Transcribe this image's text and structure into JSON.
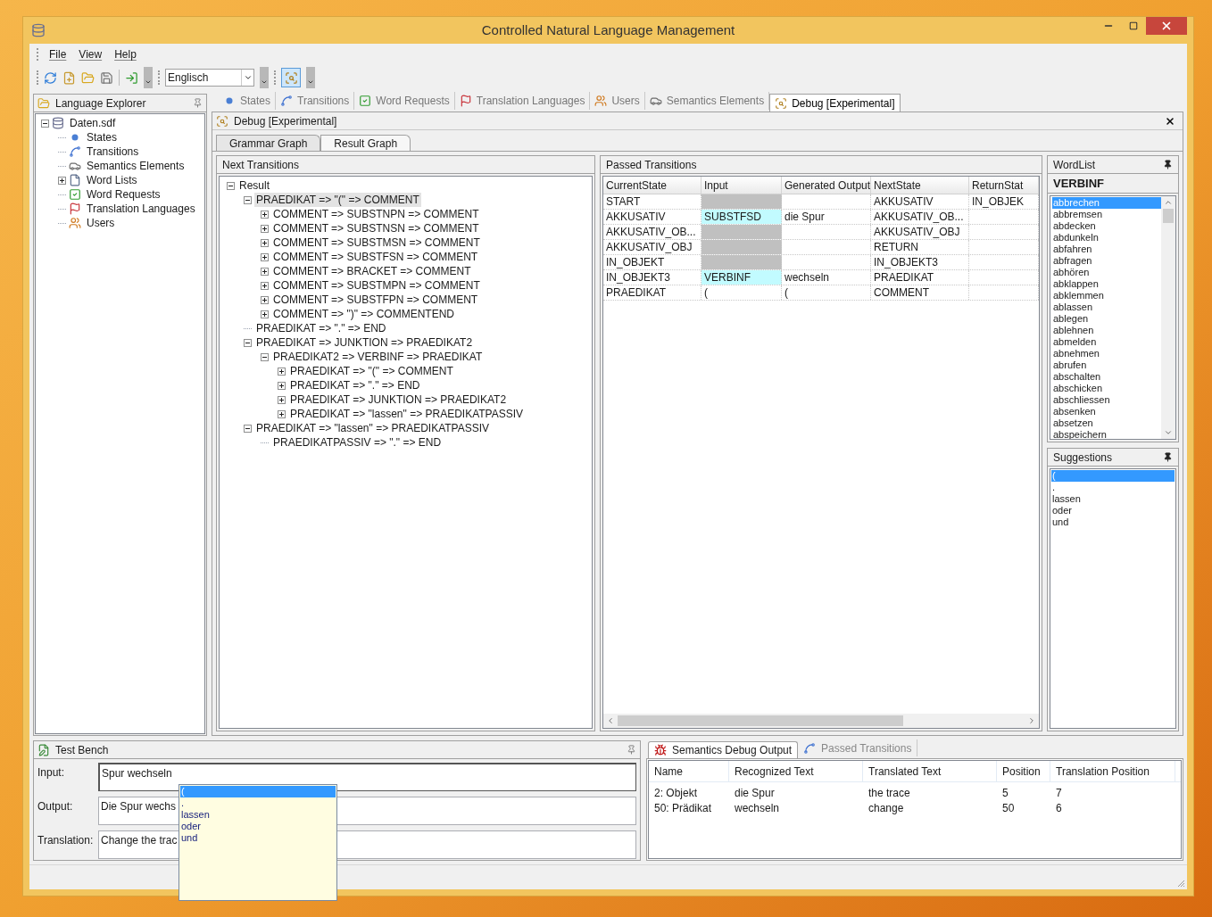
{
  "window": {
    "title": "Controlled Natural Language Management"
  },
  "menu": [
    "File",
    "View",
    "Help"
  ],
  "toolbar": {
    "language": "Englisch",
    "debug_on": true
  },
  "explorer": {
    "title": "Language Explorer",
    "tree": [
      {
        "label": "Daten.sdf",
        "expanded": true,
        "children": [
          {
            "label": "States"
          },
          {
            "label": "Transitions"
          },
          {
            "label": "Semantics Elements"
          },
          {
            "label": "Word Lists",
            "expanded": false
          },
          {
            "label": "Word Requests"
          },
          {
            "label": "Translation Languages"
          },
          {
            "label": "Users"
          }
        ]
      }
    ]
  },
  "doc_tabs": [
    {
      "label": "States",
      "selected": false
    },
    {
      "label": "Transitions",
      "selected": false
    },
    {
      "label": "Word Requests",
      "selected": false
    },
    {
      "label": "Translation Languages",
      "selected": false
    },
    {
      "label": "Users",
      "selected": false
    },
    {
      "label": "Semantics Elements",
      "selected": false
    },
    {
      "label": "Debug [Experimental]",
      "selected": true
    }
  ],
  "document": {
    "title": "Debug [Experimental]",
    "sub_tabs": [
      {
        "label": "Grammar Graph",
        "selected": false
      },
      {
        "label": "Result Graph",
        "selected": true
      }
    ]
  },
  "next_transitions": {
    "title": "Next Transitions",
    "tree": [
      {
        "label": "Result",
        "expanded": true,
        "selected": false,
        "children": [
          {
            "label": "PRAEDIKAT => \"(\" => COMMENT",
            "expanded": true,
            "selected": true,
            "children": [
              {
                "label": "COMMENT => SUBSTNPN => COMMENT",
                "expanded": false,
                "selected": false
              },
              {
                "label": "COMMENT => SUBSTNSN => COMMENT",
                "expanded": false,
                "selected": false
              },
              {
                "label": "COMMENT => SUBSTMSN => COMMENT",
                "expanded": false,
                "selected": false
              },
              {
                "label": "COMMENT => SUBSTFSN => COMMENT",
                "expanded": false,
                "selected": false
              },
              {
                "label": "COMMENT => BRACKET => COMMENT",
                "expanded": false,
                "selected": false
              },
              {
                "label": "COMMENT => SUBSTMPN => COMMENT",
                "expanded": false,
                "selected": false
              },
              {
                "label": "COMMENT => SUBSTFPN => COMMENT",
                "expanded": false,
                "selected": false
              },
              {
                "label": "COMMENT => \")\" => COMMENTEND",
                "expanded": false,
                "selected": false
              }
            ]
          },
          {
            "label": "PRAEDIKAT => \".\" => END",
            "selected": false
          },
          {
            "label": "PRAEDIKAT => JUNKTION => PRAEDIKAT2",
            "expanded": true,
            "selected": false,
            "children": [
              {
                "label": "PRAEDIKAT2 => VERBINF => PRAEDIKAT",
                "expanded": true,
                "selected": false,
                "children": [
                  {
                    "label": "PRAEDIKAT => \"(\" => COMMENT",
                    "expanded": false,
                    "selected": false
                  },
                  {
                    "label": "PRAEDIKAT => \".\" => END",
                    "expanded": false,
                    "selected": false
                  },
                  {
                    "label": "PRAEDIKAT => JUNKTION => PRAEDIKAT2",
                    "expanded": false,
                    "selected": false
                  },
                  {
                    "label": "PRAEDIKAT => \"lassen\" => PRAEDIKATPASSIV",
                    "expanded": false,
                    "selected": false
                  }
                ]
              }
            ]
          },
          {
            "label": "PRAEDIKAT => \"lassen\" => PRAEDIKATPASSIV",
            "expanded": true,
            "selected": false,
            "children": [
              {
                "label": "PRAEDIKATPASSIV => \".\" => END",
                "selected": false
              }
            ]
          }
        ]
      }
    ]
  },
  "passed_transitions": {
    "title": "Passed Transitions",
    "columns": [
      "CurrentState",
      "Input",
      "Generated Output",
      "NextState",
      "ReturnStat"
    ],
    "rows": [
      {
        "current_state": "START",
        "kind": "skipped",
        "next_state": "AKKUSATIV",
        "return_state": "IN_OBJEK"
      },
      {
        "current_state": "AKKUSATIV",
        "input": "SUBSTFSD",
        "kind": "matched",
        "generated_output": "die Spur",
        "next_state": "AKKUSATIV_OB..."
      },
      {
        "current_state": "AKKUSATIV_OB...",
        "kind": "skipped",
        "next_state": "AKKUSATIV_OBJ"
      },
      {
        "current_state": "AKKUSATIV_OBJ",
        "kind": "skipped",
        "next_state": "RETURN"
      },
      {
        "current_state": "IN_OBJEKT",
        "kind": "skipped",
        "next_state": "IN_OBJEKT3"
      },
      {
        "current_state": "IN_OBJEKT3",
        "input": "VERBINF",
        "kind": "matched",
        "generated_output": "wechseln",
        "next_state": "PRAEDIKAT"
      },
      {
        "current_state": "PRAEDIKAT",
        "input": "(",
        "kind": "literal",
        "generated_output": "(",
        "next_state": "COMMENT"
      }
    ]
  },
  "word_list": {
    "title": "WordList",
    "heading": "VERBINF",
    "items": [
      {
        "label": "abbrechen",
        "selected": true
      },
      {
        "label": "abbremsen",
        "selected": false
      },
      {
        "label": "abdecken",
        "selected": false
      },
      {
        "label": "abdunkeln",
        "selected": false
      },
      {
        "label": "abfahren",
        "selected": false
      },
      {
        "label": "abfragen",
        "selected": false
      },
      {
        "label": "abhören",
        "selected": false
      },
      {
        "label": "abklappen",
        "selected": false
      },
      {
        "label": "abklemmen",
        "selected": false
      },
      {
        "label": "ablassen",
        "selected": false
      },
      {
        "label": "ablegen",
        "selected": false
      },
      {
        "label": "ablehnen",
        "selected": false
      },
      {
        "label": "abmelden",
        "selected": false
      },
      {
        "label": "abnehmen",
        "selected": false
      },
      {
        "label": "abrufen",
        "selected": false
      },
      {
        "label": "abschalten",
        "selected": false
      },
      {
        "label": "abschicken",
        "selected": false
      },
      {
        "label": "abschliessen",
        "selected": false
      },
      {
        "label": "absenken",
        "selected": false
      },
      {
        "label": "absetzen",
        "selected": false
      },
      {
        "label": "abspeichern",
        "selected": false
      }
    ]
  },
  "suggestions": {
    "title": "Suggestions",
    "items": [
      {
        "label": "(",
        "selected": true
      },
      {
        "label": ".",
        "selected": false
      },
      {
        "label": "lassen",
        "selected": false
      },
      {
        "label": "oder",
        "selected": false
      },
      {
        "label": "und",
        "selected": false
      }
    ]
  },
  "test_bench": {
    "title": "Test Bench",
    "fields": [
      {
        "label": "Input:",
        "value": "Spur wechseln",
        "focused": true
      },
      {
        "label": "Output:",
        "value": "Die Spur wechs",
        "focused": false
      },
      {
        "label": "Translation:",
        "value": "Change the trac",
        "focused": false
      }
    ]
  },
  "autocomplete": {
    "items": [
      {
        "label": "(",
        "selected": true
      },
      {
        "label": ".",
        "selected": false
      },
      {
        "label": "lassen",
        "selected": false
      },
      {
        "label": "oder",
        "selected": false
      },
      {
        "label": "und",
        "selected": false
      }
    ]
  },
  "semantics": {
    "tabs": [
      {
        "label": "Semantics Debug Output",
        "selected": true
      },
      {
        "label": "Passed Transitions",
        "selected": false
      }
    ],
    "columns": [
      "Name",
      "Recognized Text",
      "Translated Text",
      "Position",
      "Translation Position"
    ],
    "rows": [
      [
        "2: Objekt",
        "die Spur",
        "the trace",
        "5",
        "7"
      ],
      [
        "50: Prädikat",
        "wechseln",
        "change",
        "50",
        "6"
      ]
    ]
  }
}
